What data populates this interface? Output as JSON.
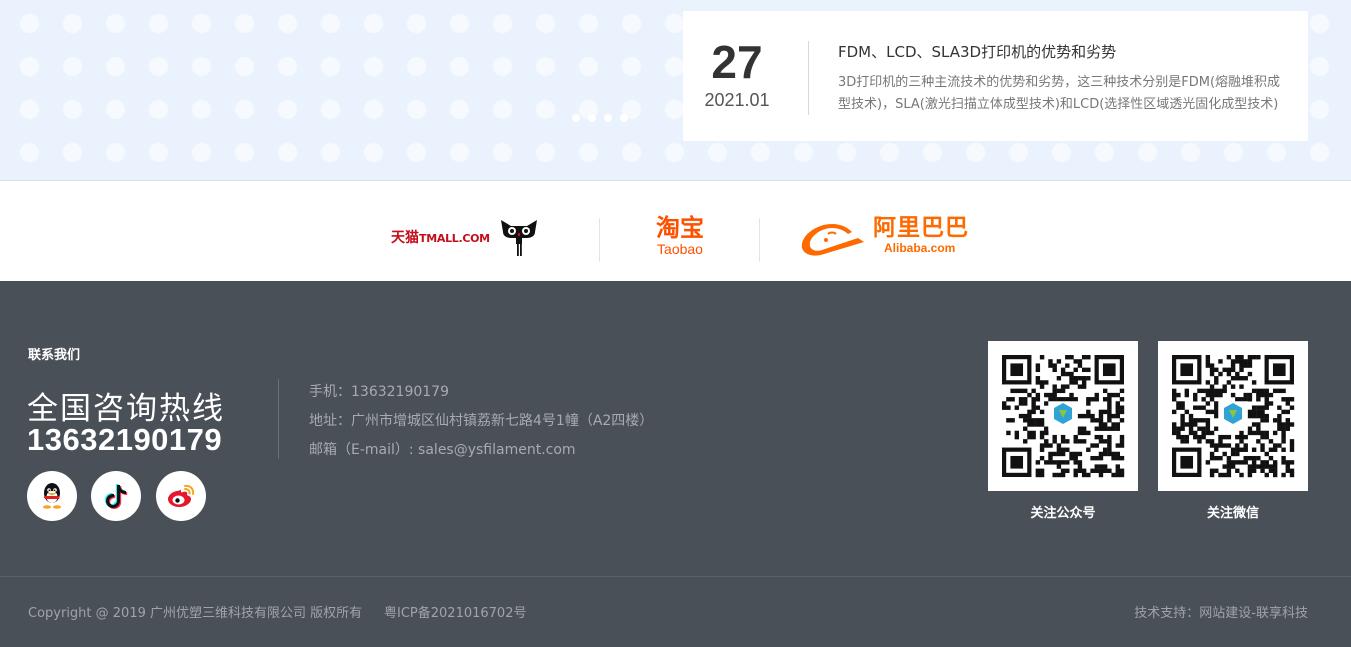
{
  "news": {
    "day": "27",
    "year_month": "2021.01",
    "title": "FDM、LCD、SLA3D打印机的优势和劣势",
    "summary": "3D打印机的三种主流技术的优势和劣势，这三种技术分别是FDM(熔融堆积成型技术)，SLA(激光扫描立体成型技术)和LCD(选择性区域透光固化成型技术)",
    "dot_count": 4
  },
  "partners": {
    "tmall_cn": "天猫",
    "tmall_en": "TMALL.COM",
    "taobao_cn": "淘宝",
    "taobao_en": "Taobao",
    "alibaba_cn": "阿里巴巴",
    "alibaba_en": "Alibaba.com"
  },
  "footer": {
    "heading": "联系我们",
    "hotline_label": "全国咨询热线",
    "hotline_number": "13632190179",
    "phone": "手机：13632190179",
    "address": "地址：广州市增城区仙村镇荔新七路4号1幢（A2四楼）",
    "email": "邮箱（E-mail）: sales@ysfilament.com",
    "qr_public_caption": "关注公众号",
    "qr_wechat_caption": "关注微信",
    "copyright": "Copyright @ 2019 广州优塑三维科技有限公司 版权所有",
    "icp": "粤ICP备2021016702号",
    "tech_support": "技术支持：网站建设-联享科技"
  },
  "icons": {
    "qq": "qq-penguin-icon",
    "douyin": "douyin-icon",
    "weibo": "weibo-icon"
  },
  "colors": {
    "footer_bg": "#4a5058",
    "tmall_red": "#c40e1c",
    "taobao_orange": "#ff5000",
    "alibaba_orange": "#ff6a00",
    "band_bg": "#eaf3fd"
  }
}
